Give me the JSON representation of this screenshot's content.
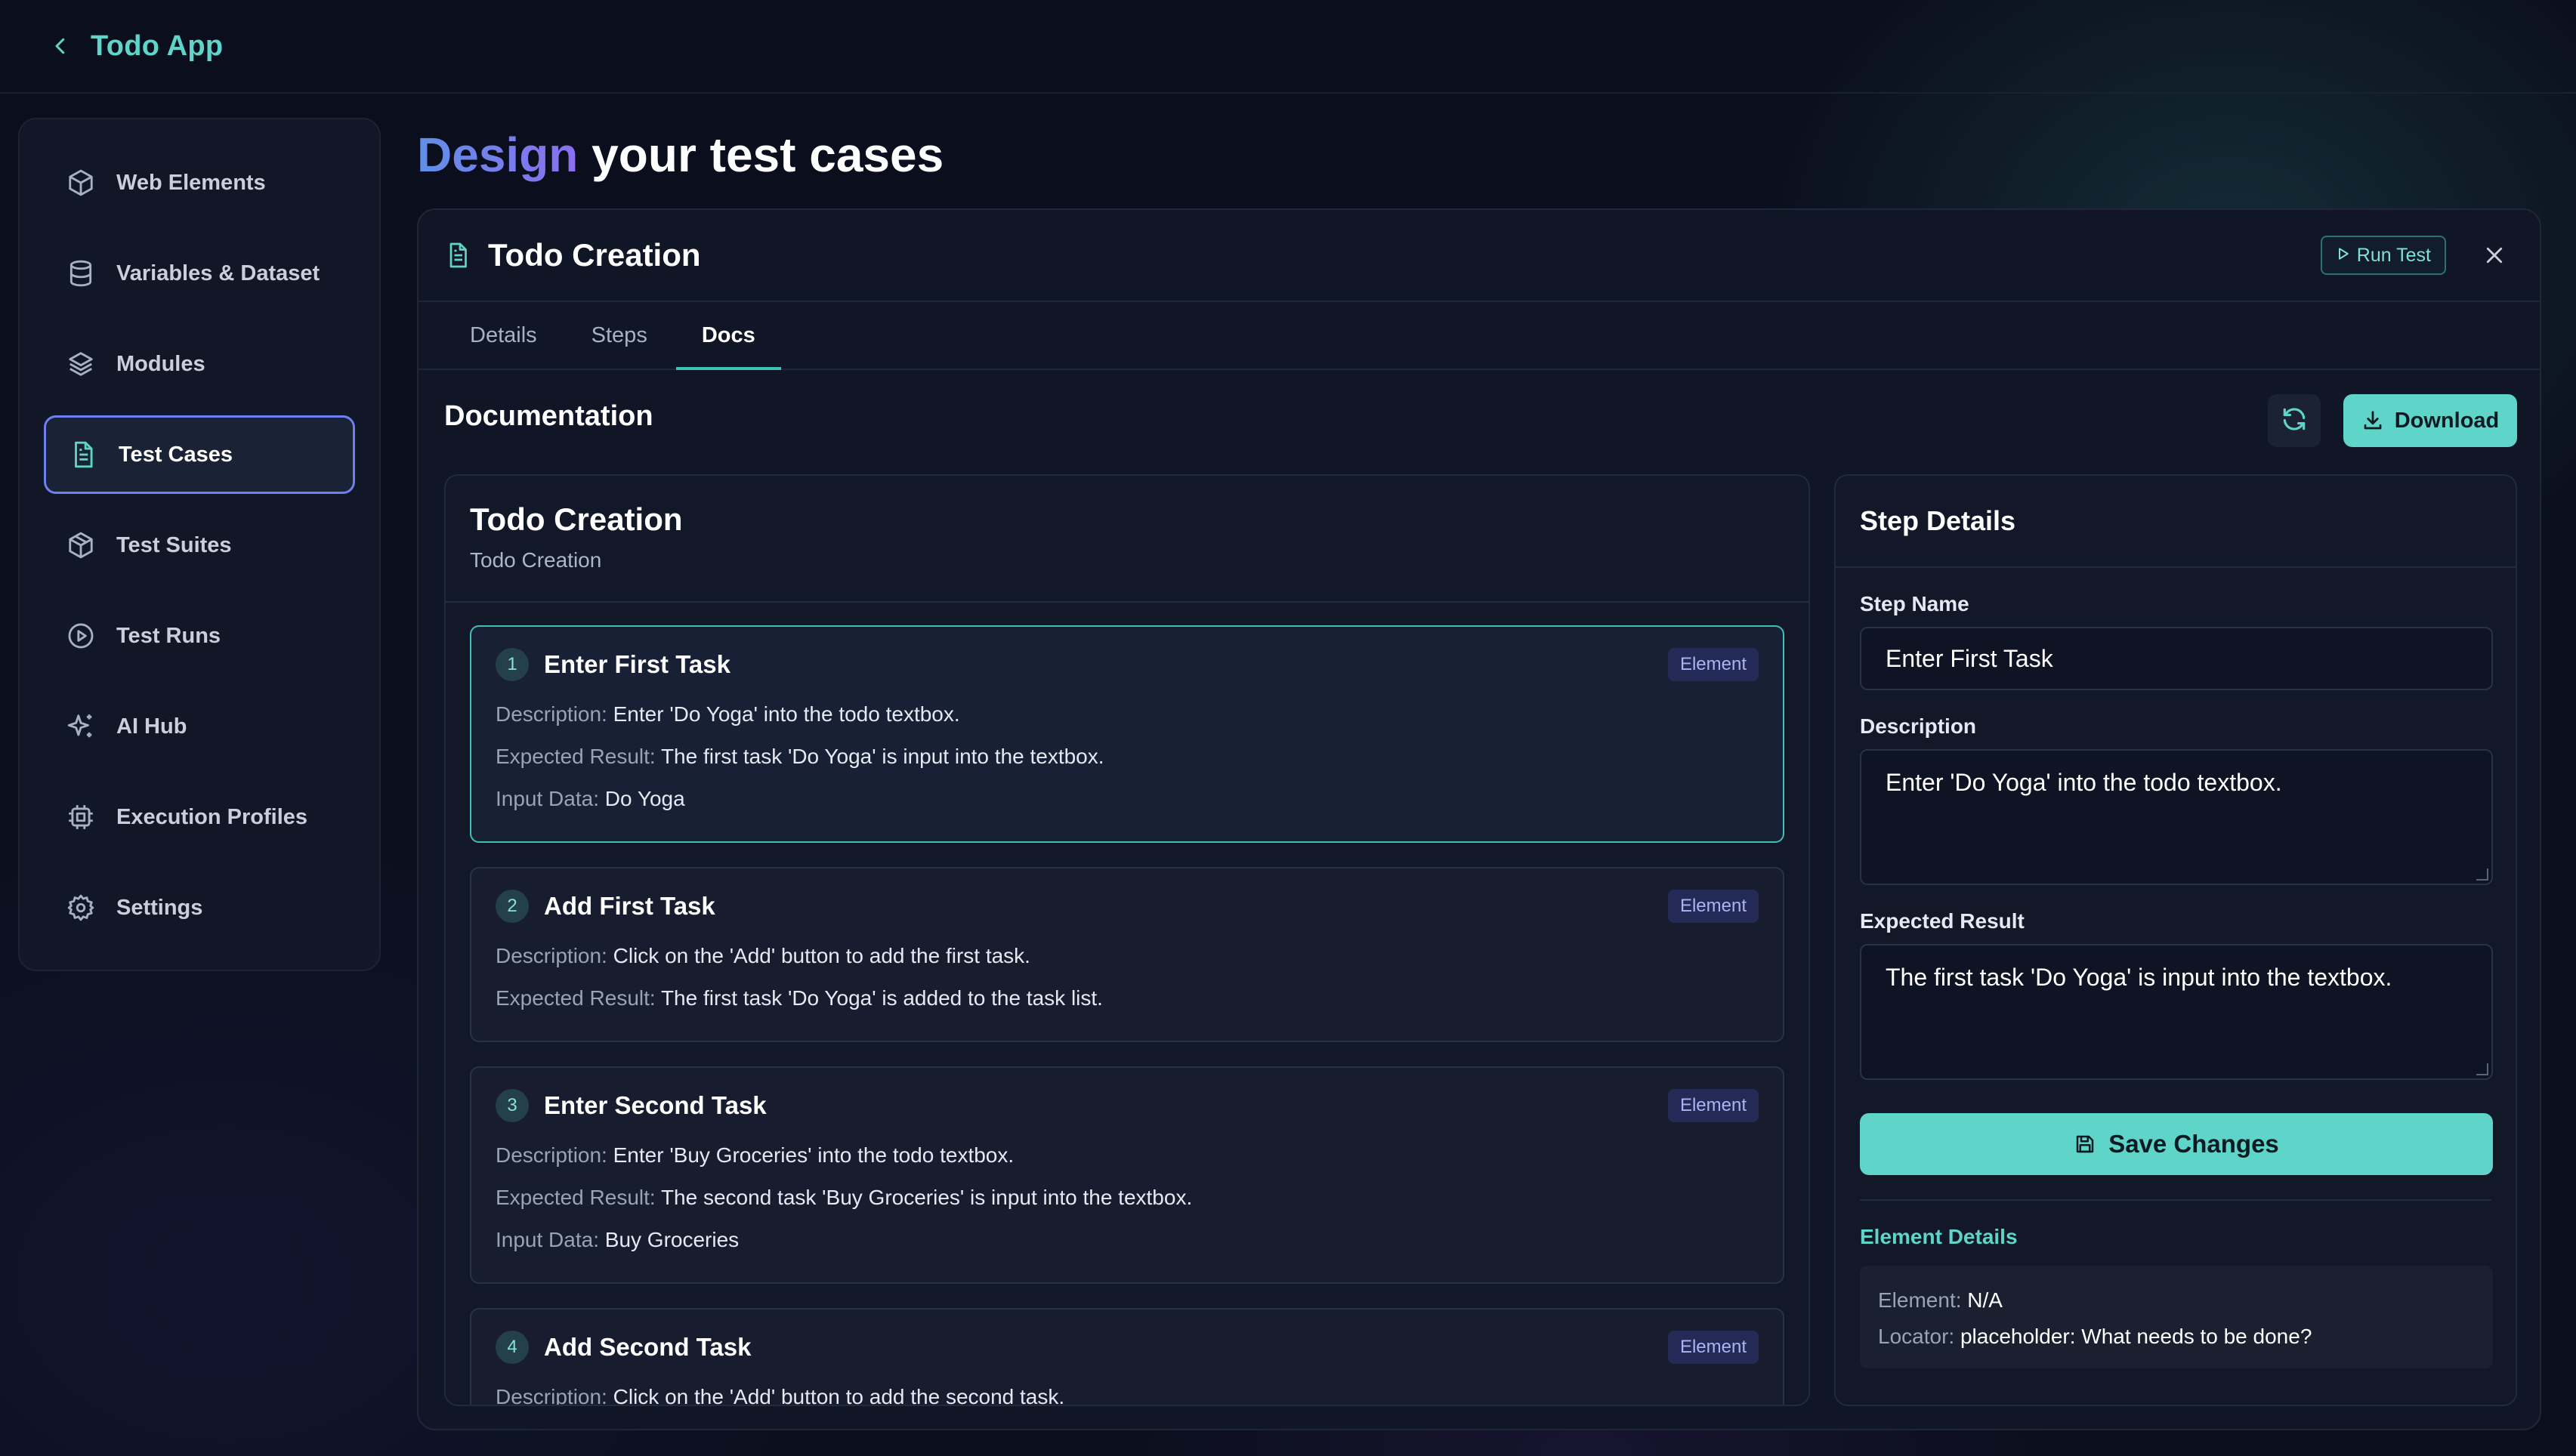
{
  "app": {
    "title": "Todo App"
  },
  "sidebar": {
    "items": [
      {
        "label": "Web Elements",
        "icon": "cube-icon"
      },
      {
        "label": "Variables & Dataset",
        "icon": "database-icon"
      },
      {
        "label": "Modules",
        "icon": "layers-icon"
      },
      {
        "label": "Test Cases",
        "icon": "file-text-icon",
        "active": true
      },
      {
        "label": "Test Suites",
        "icon": "package-icon"
      },
      {
        "label": "Test Runs",
        "icon": "play-circle-icon"
      },
      {
        "label": "AI Hub",
        "icon": "sparkles-icon"
      },
      {
        "label": "Execution Profiles",
        "icon": "cpu-icon"
      },
      {
        "label": "Settings",
        "icon": "gear-icon"
      }
    ]
  },
  "heading": {
    "accent": "Design",
    "rest": " your test cases"
  },
  "panel": {
    "title": "Todo Creation",
    "run_label": "Run Test",
    "tabs": [
      "Details",
      "Steps",
      "Docs"
    ],
    "active_tab": "Docs"
  },
  "docs": {
    "title": "Documentation",
    "download_label": "Download",
    "card_title": "Todo Creation",
    "card_subtitle": "Todo Creation",
    "desc_key": "Description:",
    "expected_key": "Expected Result:",
    "input_key": "Input Data:",
    "steps": [
      {
        "num": "1",
        "name": "Enter First Task",
        "badge": "Element",
        "description": "Enter 'Do Yoga' into the todo textbox.",
        "expected": "The first task 'Do Yoga' is input into the textbox.",
        "input": "Do Yoga"
      },
      {
        "num": "2",
        "name": "Add First Task",
        "badge": "Element",
        "description": "Click on the 'Add' button to add the first task.",
        "expected": "The first task 'Do Yoga' is added to the task list."
      },
      {
        "num": "3",
        "name": "Enter Second Task",
        "badge": "Element",
        "description": "Enter 'Buy Groceries' into the todo textbox.",
        "expected": "The second task 'Buy Groceries' is input into the textbox.",
        "input": "Buy Groceries"
      },
      {
        "num": "4",
        "name": "Add Second Task",
        "badge": "Element",
        "description": "Click on the 'Add' button to add the second task."
      }
    ]
  },
  "step_details": {
    "title": "Step Details",
    "name_label": "Step Name",
    "name_value": "Enter First Task",
    "description_label": "Description",
    "description_value": "Enter 'Do Yoga' into the todo textbox.",
    "expected_label": "Expected Result",
    "expected_value": "The first task 'Do Yoga' is input into the textbox.",
    "save_label": "Save Changes",
    "element_details_label": "Element Details",
    "element_key": "Element:",
    "element_value": "N/A",
    "locator_key": "Locator:",
    "locator_value": "placeholder: What needs to be done?"
  },
  "colors": {
    "accent": "#5fd4c9",
    "active_border": "#6f7ff0",
    "background": "#0b0f1d"
  }
}
